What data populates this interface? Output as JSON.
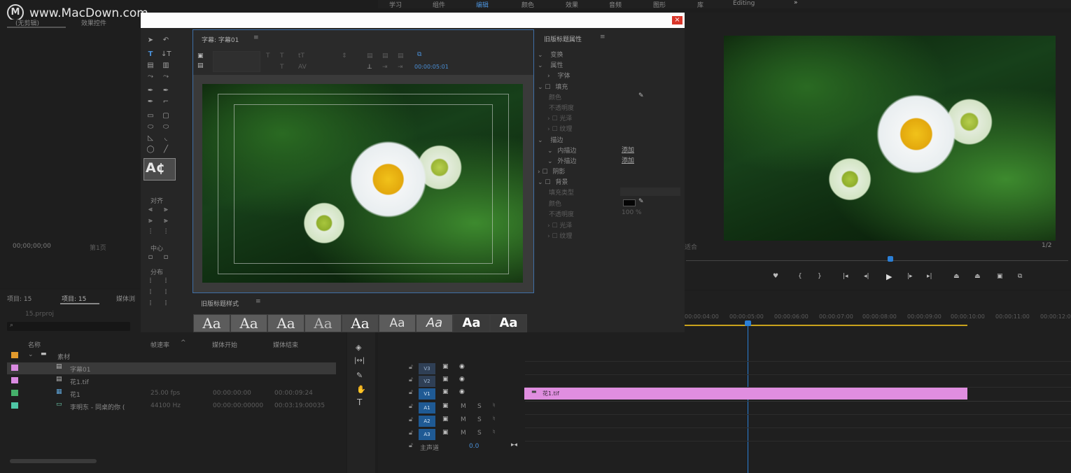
{
  "watermark": {
    "text": "www.MacDown.com"
  },
  "workspace_tabs": [
    "学习",
    "组件",
    "编辑",
    "颜色",
    "效果",
    "音频",
    "图形",
    "库",
    "Editing",
    "»"
  ],
  "source_panel": {
    "tabs": [
      "(无剪辑)",
      "效果控件"
    ],
    "timecode": "00;00;00;00",
    "page": "第1页"
  },
  "title_window": {
    "close": "×"
  },
  "title_editor": {
    "title": "字幕: 字幕01",
    "timecode": "00:00:05:01"
  },
  "title_tools": {
    "glyph_label": "A¢",
    "align_label": "对齐",
    "center_label": "中心",
    "distribute_label": "分布"
  },
  "title_styles": {
    "title": "旧版标题样式",
    "swatch": "Aa"
  },
  "title_properties": {
    "title": "旧版标题属性",
    "rows": [
      "变换",
      "属性",
      "字体",
      "填充",
      "颜色",
      "不透明度",
      "光泽",
      "纹理",
      "描边",
      "内描边",
      "外描边",
      "阴影",
      "背景",
      "填充类型",
      "颜色",
      "不透明度",
      "光泽",
      "纹理"
    ],
    "add1": "添加",
    "add2": "添加",
    "percent": "100 %"
  },
  "program_monitor": {
    "page": "1/2",
    "fit": "适合"
  },
  "project_panel": {
    "tabs": [
      "项目: 15",
      "项目: 15",
      "媒体浏"
    ],
    "file": "15.prproj",
    "search_placeholder": "",
    "columns": [
      "名称",
      "帧速率",
      "媒体开始",
      "媒体结束"
    ],
    "items": [
      {
        "name": "素材",
        "fps": "",
        "start": "",
        "end": "",
        "color": "#e29a2c"
      },
      {
        "name": "字幕01",
        "fps": "",
        "start": "",
        "end": "",
        "color": "#d98ae0"
      },
      {
        "name": "花1.tif",
        "fps": "",
        "start": "",
        "end": "",
        "color": "#d98ae0"
      },
      {
        "name": "花1",
        "fps": "25.00 fps",
        "start": "00:00:00:00",
        "end": "00:00:09:24",
        "color": "#45b06a"
      },
      {
        "name": "李明东 - 同桌的你 (",
        "fps": "44100 Hz",
        "start": "00:00:00:00000",
        "end": "00:03:19:00035",
        "color": "#4fc7a6"
      }
    ]
  },
  "timeline": {
    "ruler": [
      "00:00:04:00",
      "00:00:05:00",
      "00:00:06:00",
      "00:00:07:00",
      "00:00:08:00",
      "00:00:09:00",
      "00:00:10:00",
      "00:00:11:00",
      "00:00:12:00"
    ],
    "video_tracks": [
      "V3",
      "V2",
      "V1"
    ],
    "audio_tracks": [
      "A1",
      "A2",
      "A3"
    ],
    "master_label": "主声道",
    "master_value": "0.0",
    "clip_label": "花1.tif"
  },
  "colors": {
    "accent": "#2b7fd6",
    "clip": "#e08ee0"
  }
}
